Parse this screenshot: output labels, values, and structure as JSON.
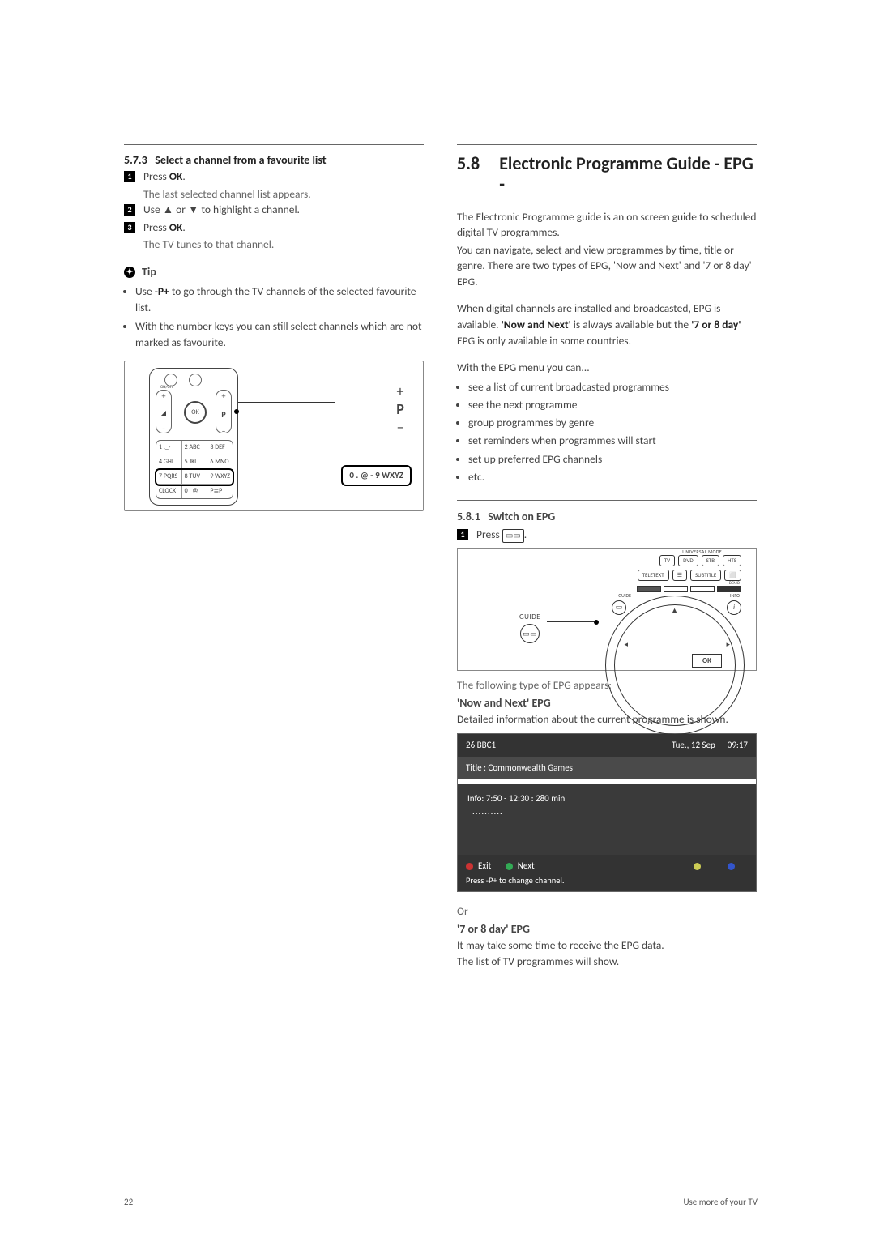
{
  "left": {
    "sub573_num": "5.7.3",
    "sub573_title": "Select a channel from a favourite list",
    "step1_num": "1",
    "step1": "Press ",
    "step1_b": "OK",
    "step1_p": ".",
    "step1_sub": "The last selected channel list appears.",
    "step2_num": "2",
    "step2a": "Use ",
    "step2b": " or ",
    "step2c": " to highlight a channel.",
    "step3_num": "3",
    "step3": "Press ",
    "step3_b": "OK",
    "step3_p": ".",
    "step3_sub": "The TV tunes to that channel.",
    "tip_head": "Tip",
    "tip_b1a": "Use ",
    "tip_b1b": "-P+",
    "tip_b1c": " to go through the TV channels of the selected favourite list.",
    "tip_b2": "With the number keys you can still select channels which are not marked as favourite.",
    "remote": {
      "ok": "OK",
      "p": "P",
      "numpad": [
        [
          "1 ._-",
          "2 ABC",
          "3 DEF"
        ],
        [
          "4 GHI",
          "5 JKL",
          "6 MNO"
        ],
        [
          "7 PQRS",
          "8 TUV",
          "9 WXYZ"
        ],
        [
          "CLOCK",
          "0 . @",
          "P≣P"
        ]
      ],
      "big_plus": "+",
      "big_minus": "–",
      "label_right": "0 . @  -  9 WXYZ"
    }
  },
  "right": {
    "secnum": "5.8",
    "sectitle": "Electronic Programme Guide - EPG -",
    "intro1": "The Electronic Programme guide is an on screen guide to scheduled digital TV programmes.",
    "intro2": "You can navigate, select and view programmes by time, title or genre. There are two types of EPG, 'Now and Next' and '7 or 8 day' EPG.",
    "intro3a": "When digital channels are installed and broadcasted, EPG is available. ",
    "intro3b": "'Now and Next'",
    "intro3c": " is always available but the ",
    "intro3d": "'7 or 8 day'",
    "intro3e": " EPG is only available in some countries.",
    "intro4": "With the EPG menu you can...",
    "bullets": [
      "see a list of current broadcasted programmes",
      "see the next programme",
      "group programmes by genre",
      "set reminders when programmes will start",
      "set up preferred EPG channels",
      "etc."
    ],
    "sub581_num": "5.8.1",
    "sub581_title": "Switch on EPG",
    "sub581_step": "1",
    "sub581_txt": "Press ",
    "sub581_icon": "☿",
    "sub581_p": ".",
    "guide_lbl": "GUIDE",
    "toprow": [
      "TV",
      "DVD",
      "STB",
      "HTS"
    ],
    "secrow": [
      "TELETEXT",
      "☰",
      "SUBTITLE",
      "⬜"
    ],
    "colorrow": [
      "",
      "",
      "",
      ""
    ],
    "gd_left": "GUIDE",
    "gd_right": "INFO",
    "ok": "OK",
    "univ": "UNIVERSAL MODE",
    "after_diag": "The following type of EPG appears:",
    "nn_head": "'Now and Next' EPG",
    "nn_body": "Detailed information about the current programme is shown.",
    "epg": {
      "ch": "26   BBC1",
      "date": "Tue., 12 Sep",
      "time": "09:17",
      "title": "Title : Commonwealth Games",
      "info": "Info: 7:50 - 12:30 : 280 min",
      "dots": "..........",
      "exit": "Exit",
      "next": "Next",
      "ftr": "Press -P+ to change channel."
    },
    "or": "Or",
    "d78_head": "'7 or 8 day' EPG",
    "d78_body1": "It may take some time to receive the EPG data.",
    "d78_body2": "The list of TV programmes will show."
  },
  "footer": {
    "page": "22",
    "label": "Use more of your TV"
  }
}
